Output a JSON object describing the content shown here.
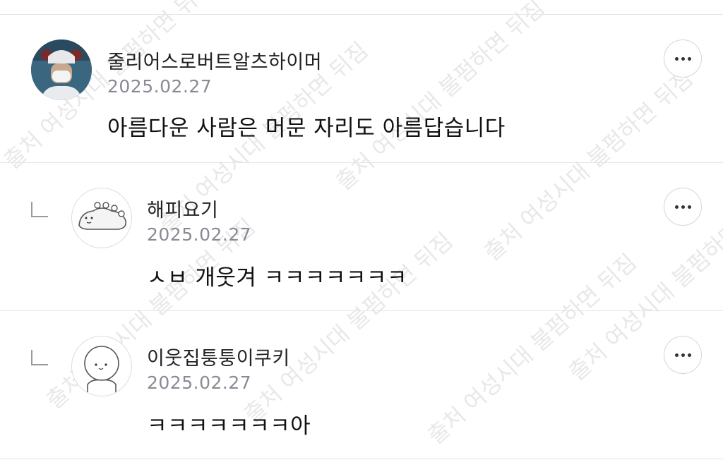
{
  "comments": [
    {
      "author": "줄리어스로버트알츠하이머",
      "date": "2025.02.27",
      "text": "아름다운 사람은 머문 자리도 아름답습니다",
      "avatar_icon": "masked-person-avatar"
    },
    {
      "author": "해피요기",
      "date": "2025.02.27",
      "text": "ㅅㅂ 개웃겨 ㅋㅋㅋㅋㅋㅋㅋ",
      "avatar_icon": "dinosaur-doodle-avatar",
      "is_reply": true
    },
    {
      "author": "이웃집퉁퉁이쿠키",
      "date": "2025.02.27",
      "text": "ㅋㅋㅋㅋㅋㅋㅋ아",
      "avatar_icon": "round-face-doodle-avatar",
      "is_reply": true
    }
  ],
  "more_icon": "ellipsis-icon",
  "reply_icon": "reply-arrow-icon",
  "watermark_text": "출처 여성시대 불펌하면 뒤짐"
}
